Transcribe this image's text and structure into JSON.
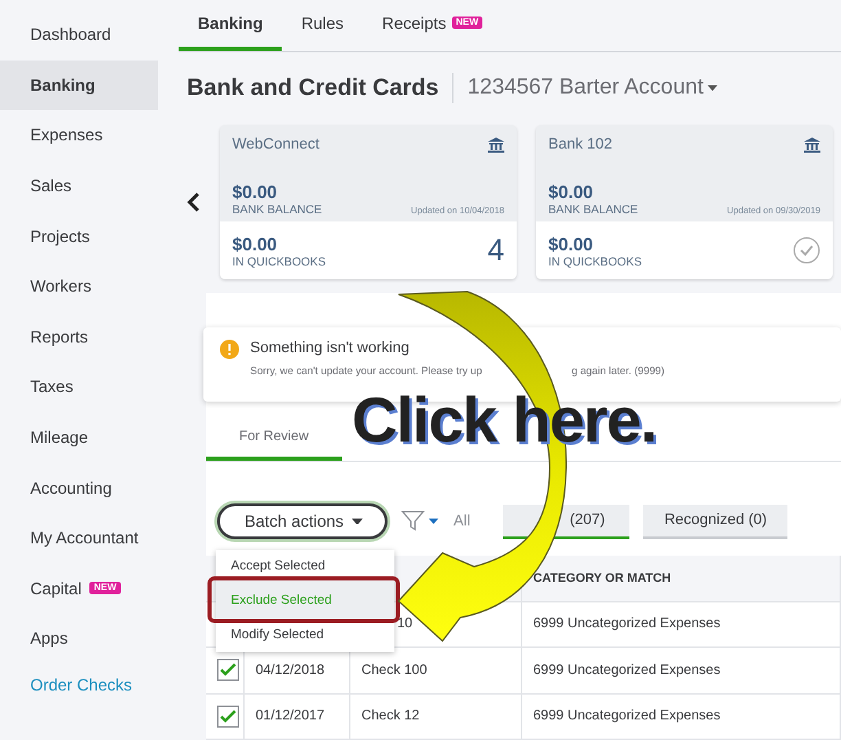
{
  "sidebar": {
    "items": [
      {
        "label": "Dashboard",
        "selected": false
      },
      {
        "label": "Banking",
        "selected": true
      },
      {
        "label": "Expenses",
        "selected": false
      },
      {
        "label": "Sales",
        "selected": false
      },
      {
        "label": "Projects",
        "selected": false
      },
      {
        "label": "Workers",
        "selected": false
      },
      {
        "label": "Reports",
        "selected": false
      },
      {
        "label": "Taxes",
        "selected": false
      },
      {
        "label": "Mileage",
        "selected": false
      },
      {
        "label": "Accounting",
        "selected": false
      },
      {
        "label": "My Accountant",
        "selected": false
      },
      {
        "label": "Capital",
        "selected": false,
        "badge": "NEW"
      },
      {
        "label": "Apps",
        "selected": false
      }
    ],
    "link": "Order Checks"
  },
  "tabs": [
    {
      "label": "Banking",
      "selected": true
    },
    {
      "label": "Rules",
      "selected": false
    },
    {
      "label": "Receipts",
      "selected": false,
      "badge": "NEW"
    }
  ],
  "header": {
    "title": "Bank and Credit Cards",
    "account": "1234567 Barter Account"
  },
  "accounts": [
    {
      "name": "WebConnect",
      "bank_balance": "$0.00",
      "bank_label": "BANK BALANCE",
      "updated": "Updated on 10/04/2018",
      "qb_balance": "$0.00",
      "qb_label": "IN QUICKBOOKS",
      "kind": "count",
      "count": "4"
    },
    {
      "name": "Bank 102",
      "bank_balance": "$0.00",
      "bank_label": "BANK BALANCE",
      "updated": "Updated on 09/30/2019",
      "qb_balance": "$0.00",
      "qb_label": "IN QUICKBOOKS",
      "kind": "check"
    }
  ],
  "alert": {
    "title": "Something isn't working",
    "message": "Sorry, we can't update your account. Please try up",
    "message_end": "g again later. (9999)"
  },
  "review_tabs": [
    {
      "label": "For Review",
      "selected": true
    }
  ],
  "toolbar": {
    "batch": "Batch actions",
    "all": "All",
    "pills": [
      {
        "label": "(207)",
        "selected": true
      },
      {
        "label": "Recognized (0)",
        "selected": false
      }
    ]
  },
  "batch_menu": [
    {
      "label": "Accept Selected",
      "selected": false
    },
    {
      "label": "Exclude Selected",
      "selected": true
    },
    {
      "label": "Modify Selected",
      "selected": false
    }
  ],
  "table": {
    "columns": [
      "CATEGORY OR MATCH"
    ],
    "rows": [
      {
        "date": "",
        "description": "10",
        "category": "6999 Uncategorized Expenses"
      },
      {
        "checked": true,
        "date": "04/12/2018",
        "description": "Check 100",
        "category": "6999 Uncategorized Expenses"
      },
      {
        "checked": true,
        "date": "01/12/2017",
        "description": "Check 12",
        "category": "6999 Uncategorized Expenses"
      }
    ]
  },
  "annotation": {
    "text": "Click here."
  }
}
